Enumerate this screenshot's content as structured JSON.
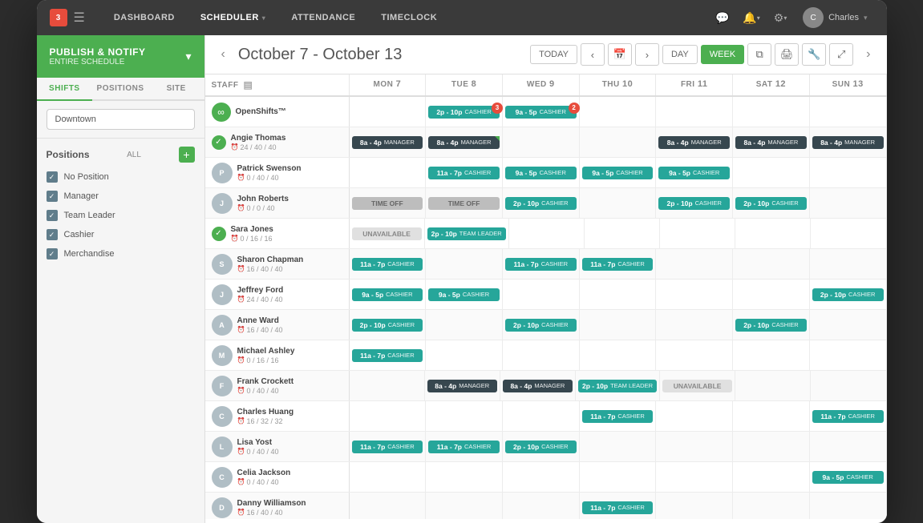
{
  "nav": {
    "logo_badge": "3",
    "items": [
      {
        "label": "DASHBOARD",
        "active": false
      },
      {
        "label": "SCHEDULER",
        "active": true,
        "has_caret": true
      },
      {
        "label": "ATTENDANCE",
        "active": false
      },
      {
        "label": "TIMECLOCK",
        "active": false
      }
    ],
    "user": "Charles"
  },
  "sidebar": {
    "publish_title": "PUBLISH & NOTIFY",
    "publish_sub": "ENTIRE SCHEDULE",
    "tabs": [
      "SHIFTS",
      "POSITIONS",
      "SITE"
    ],
    "active_tab": "SHIFTS",
    "location": "Downtown",
    "positions_title": "Positions",
    "positions_all": "ALL",
    "positions": [
      {
        "label": "No Position",
        "checked": true
      },
      {
        "label": "Manager",
        "checked": true
      },
      {
        "label": "Team Leader",
        "checked": true
      },
      {
        "label": "Cashier",
        "checked": true
      },
      {
        "label": "Merchandise",
        "checked": true
      }
    ]
  },
  "scheduler": {
    "date_range": "October 7 - October 13",
    "columns": [
      {
        "label": "STAFF",
        "day": ""
      },
      {
        "label": "MON",
        "day": "7"
      },
      {
        "label": "TUE",
        "day": "8"
      },
      {
        "label": "WED",
        "day": "9"
      },
      {
        "label": "THU",
        "day": "10"
      },
      {
        "label": "FRI",
        "day": "11"
      },
      {
        "label": "SAT",
        "day": "12"
      },
      {
        "label": "SUN",
        "day": "13"
      }
    ],
    "rows": [
      {
        "type": "open",
        "name": "OpenShifts™",
        "hours": "",
        "cells": [
          null,
          {
            "time": "2p - 10p",
            "pos": "CASHIER",
            "type": "cashier",
            "count": 3
          },
          {
            "time": "9a - 5p",
            "pos": "CASHIER",
            "type": "cashier",
            "count": 2
          },
          null,
          null,
          null,
          null
        ]
      },
      {
        "type": "checked",
        "name": "Angie Thomas",
        "hours": "24 / 40 / 40",
        "cells": [
          {
            "time": "8a - 4p",
            "pos": "MANAGER",
            "type": "manager"
          },
          {
            "time": "8a - 4p",
            "pos": "MANAGER",
            "type": "manager",
            "corner": true
          },
          null,
          null,
          {
            "time": "8a - 4p",
            "pos": "MANAGER",
            "type": "manager"
          },
          {
            "time": "8a - 4p",
            "pos": "MANAGER",
            "type": "manager"
          },
          {
            "time": "8a - 4p",
            "pos": "MANAGER",
            "type": "manager"
          }
        ]
      },
      {
        "type": "normal",
        "name": "Patrick Swenson",
        "hours": "0 / 40 / 40",
        "cells": [
          null,
          {
            "time": "11a - 7p",
            "pos": "CASHIER",
            "type": "cashier"
          },
          {
            "time": "9a - 5p",
            "pos": "CASHIER",
            "type": "cashier"
          },
          {
            "time": "9a - 5p",
            "pos": "CASHIER",
            "type": "cashier"
          },
          {
            "time": "9a - 5p",
            "pos": "CASHIER",
            "type": "cashier"
          },
          null,
          null
        ]
      },
      {
        "type": "normal",
        "name": "John Roberts",
        "hours": "0 / 0 / 40",
        "cells": [
          {
            "time": "TIME OFF",
            "pos": "",
            "type": "timeoff"
          },
          {
            "time": "TIME OFF",
            "pos": "",
            "type": "timeoff"
          },
          {
            "time": "2p - 10p",
            "pos": "CASHIER",
            "type": "cashier"
          },
          null,
          {
            "time": "2p - 10p",
            "pos": "CASHIER",
            "type": "cashier"
          },
          {
            "time": "2p - 10p",
            "pos": "CASHIER",
            "type": "cashier"
          },
          null
        ]
      },
      {
        "type": "checked",
        "name": "Sara Jones",
        "hours": "0 / 16 / 16",
        "cells": [
          {
            "time": "UNAVAILABLE",
            "pos": "",
            "type": "unavailable"
          },
          {
            "time": "2p - 10p",
            "pos": "TEAM LEADER",
            "type": "teamlead"
          },
          null,
          null,
          null,
          null,
          null
        ]
      },
      {
        "type": "normal",
        "name": "Sharon Chapman",
        "hours": "16 / 40 / 40",
        "cells": [
          {
            "time": "11a - 7p",
            "pos": "CASHIER",
            "type": "cashier"
          },
          null,
          {
            "time": "11a - 7p",
            "pos": "CASHIER",
            "type": "cashier"
          },
          {
            "time": "11a - 7p",
            "pos": "CASHIER",
            "type": "cashier"
          },
          null,
          null,
          null
        ]
      },
      {
        "type": "normal",
        "name": "Jeffrey Ford",
        "hours": "24 / 40 / 40",
        "cells": [
          {
            "time": "9a - 5p",
            "pos": "CASHIER",
            "type": "cashier"
          },
          {
            "time": "9a - 5p",
            "pos": "CASHIER",
            "type": "cashier"
          },
          null,
          null,
          null,
          null,
          {
            "time": "2p - 10p",
            "pos": "CASHIER",
            "type": "cashier"
          }
        ]
      },
      {
        "type": "normal",
        "name": "Anne Ward",
        "hours": "16 / 40 / 40",
        "cells": [
          {
            "time": "2p - 10p",
            "pos": "CASHIER",
            "type": "cashier"
          },
          null,
          {
            "time": "2p - 10p",
            "pos": "CASHIER",
            "type": "cashier"
          },
          null,
          null,
          {
            "time": "2p - 10p",
            "pos": "CASHIER",
            "type": "cashier"
          },
          null
        ]
      },
      {
        "type": "normal",
        "name": "Michael Ashley",
        "hours": "0 / 16 / 16",
        "cells": [
          {
            "time": "11a - 7p",
            "pos": "CASHIER",
            "type": "cashier"
          },
          null,
          null,
          null,
          null,
          null,
          null
        ]
      },
      {
        "type": "normal",
        "name": "Frank Crockett",
        "hours": "0 / 40 / 40",
        "cells": [
          null,
          {
            "time": "8a - 4p",
            "pos": "MANAGER",
            "type": "manager"
          },
          {
            "time": "8a - 4p",
            "pos": "MANAGER",
            "type": "manager"
          },
          {
            "time": "2p - 10p",
            "pos": "TEAM LEADER",
            "type": "teamlead"
          },
          {
            "time": "UNAVAILABLE",
            "pos": "",
            "type": "unavailable"
          },
          null,
          null
        ]
      },
      {
        "type": "normal",
        "name": "Charles Huang",
        "hours": "16 / 32 / 32",
        "cells": [
          null,
          null,
          null,
          {
            "time": "11a - 7p",
            "pos": "CASHIER",
            "type": "cashier"
          },
          null,
          null,
          {
            "time": "11a - 7p",
            "pos": "CASHIER",
            "type": "cashier"
          }
        ]
      },
      {
        "type": "normal",
        "name": "Lisa Yost",
        "hours": "0 / 40 / 40",
        "cells": [
          {
            "time": "11a - 7p",
            "pos": "CASHIER",
            "type": "cashier"
          },
          {
            "time": "11a - 7p",
            "pos": "CASHIER",
            "type": "cashier"
          },
          {
            "time": "2p - 10p",
            "pos": "CASHIER",
            "type": "cashier"
          },
          null,
          null,
          null,
          null
        ]
      },
      {
        "type": "normal",
        "name": "Celia Jackson",
        "hours": "0 / 40 / 40",
        "cells": [
          null,
          null,
          null,
          null,
          null,
          null,
          {
            "time": "9a - 5p",
            "pos": "CASHIER",
            "type": "cashier"
          }
        ]
      },
      {
        "type": "normal",
        "name": "Danny Williamson",
        "hours": "16 / 40 / 40",
        "cells": [
          null,
          null,
          null,
          {
            "time": "11a - 7p",
            "pos": "CASHIER",
            "type": "cashier"
          },
          null,
          null,
          null
        ]
      }
    ]
  }
}
